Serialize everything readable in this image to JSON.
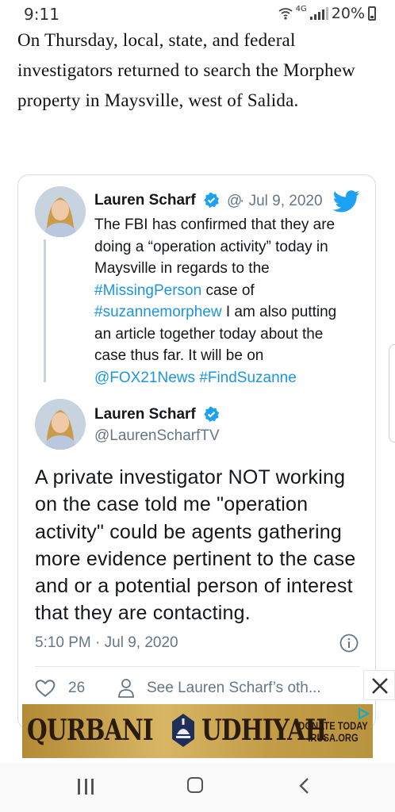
{
  "status_bar": {
    "time": "9:11",
    "network": "4G",
    "battery": "20%"
  },
  "article": {
    "paragraph": "On Thursday, local, state, and federal investigators returned to search the Morphew property in Maysville, west of Salida."
  },
  "quoted_tweet": {
    "author_name": "Lauren Scharf",
    "handle_fragment": "@",
    "date": "· Jul 9, 2020",
    "text_parts": {
      "p1": "The FBI has confirmed that they are doing a “operation activity” today in Maysville in regards to the ",
      "link1": "#MissingPerson",
      "p2": " case of ",
      "link2": "#suzannemorphew",
      "p3": " I am also putting an article together today about the case thus far. It will be on ",
      "link3": "@FOX21News",
      "p4": " ",
      "link4": "#FindSuzanne"
    }
  },
  "reply_tweet": {
    "author_name": "Lauren Scharf",
    "handle": "@LaurenScharfTV",
    "text": "A private investigator NOT working on the case told me \"operation activity\" could be agents gathering more evidence pertinent to the case and or a potential person of interest that they are contacting.",
    "timestamp": "5:10 PM · Jul 9, 2020",
    "likes": "26",
    "see_more": "See Lauren Scharf’s oth..."
  },
  "ad": {
    "word1": "QURBANI",
    "word2": "UDHIYAH",
    "donate_line1": "DONATE TODAY",
    "donate_line2": "IRUSA.ORG"
  },
  "colors": {
    "link": "#1b95e0",
    "verified": "#1da1f2",
    "twitter": "#1da1f2",
    "muted": "#657786"
  },
  "icons": [
    "wifi-icon",
    "signal-icon",
    "battery-icon",
    "verified-icon",
    "twitter-bird-icon",
    "info-icon",
    "heart-icon",
    "person-icon",
    "close-icon",
    "adchoices-icon",
    "recent-apps-icon",
    "home-icon",
    "back-icon"
  ]
}
